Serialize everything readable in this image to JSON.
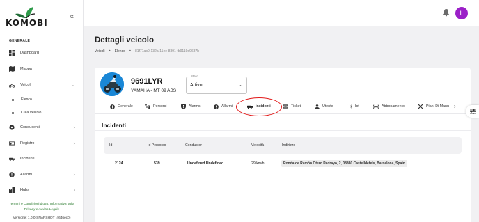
{
  "app": {
    "logo_text": "KOMOBI",
    "avatar_initial": "L",
    "avatar_color": "#9b20c8",
    "accent_green": "#2e7d32"
  },
  "sidebar": {
    "section_label": "GENERALE",
    "items": [
      {
        "label": "Dashboard",
        "icon": "dashboard-icon"
      },
      {
        "label": "Mappa",
        "icon": "map-icon"
      },
      {
        "label": "Veicoli",
        "icon": "motorcycle-icon",
        "expanded": true
      },
      {
        "label": "Conducenti",
        "icon": "driver-icon"
      },
      {
        "label": "Registro",
        "icon": "registry-icon"
      },
      {
        "label": "Incidenti",
        "icon": "incident-icon"
      },
      {
        "label": "Allarmi",
        "icon": "alert-icon"
      },
      {
        "label": "Hubs",
        "icon": "hub-icon"
      }
    ],
    "subitems": [
      {
        "label": "Elenco"
      },
      {
        "label": "Crea Veicolo"
      }
    ],
    "footer_line1": "Termini e Condizioni d'uso, Informativa sulla",
    "footer_line2": "Privacy e Avviso Legale",
    "version": "Versione: 1.0.0-SNAPSHOT (4646ec0)"
  },
  "page": {
    "title": "Dettagli veicolo",
    "breadcrumb": [
      "Veicoli",
      "Elenco",
      "81f71ab0-132a-11ee-8391-fb9119d9687b"
    ]
  },
  "vehicle": {
    "plate": "9691LYR",
    "model": "YAMAHA - MT 09 ABS",
    "stato_label": "Stato",
    "stato_value": "Attivo"
  },
  "tabs": [
    {
      "label": "Generale",
      "icon": "info-icon"
    },
    {
      "label": "Percorsi",
      "icon": "route-icon"
    },
    {
      "label": "Alarms",
      "icon": "shield-icon"
    },
    {
      "label": "Allarmi",
      "icon": "alert-icon"
    },
    {
      "label": "Incidenti",
      "icon": "car-crash-icon",
      "active": true
    },
    {
      "label": "Ticket",
      "icon": "ticket-icon"
    },
    {
      "label": "Utente",
      "icon": "user-icon"
    },
    {
      "label": "Iot",
      "icon": "iot-device-icon"
    },
    {
      "label": "Abbonamento",
      "icon": "signal-icon"
    },
    {
      "label": "Piani Di Manu",
      "icon": "wrench-icon"
    }
  ],
  "incidents": {
    "title": "Incidenti",
    "columns": [
      "Id",
      "Id Percorso",
      "Conductor",
      "Velocità",
      "Indirizzo"
    ],
    "rows": [
      {
        "id": "2124",
        "route_id": "539",
        "conductor": "Undefined Undefined",
        "speed": "29 km/h",
        "address": "Ronda de Ramón Otero Pedrayo, 2, 08860 Castelldefels, Barcelona, Spain"
      }
    ]
  },
  "annotation": {
    "color": "#e21b1b",
    "target": "Incidenti"
  }
}
